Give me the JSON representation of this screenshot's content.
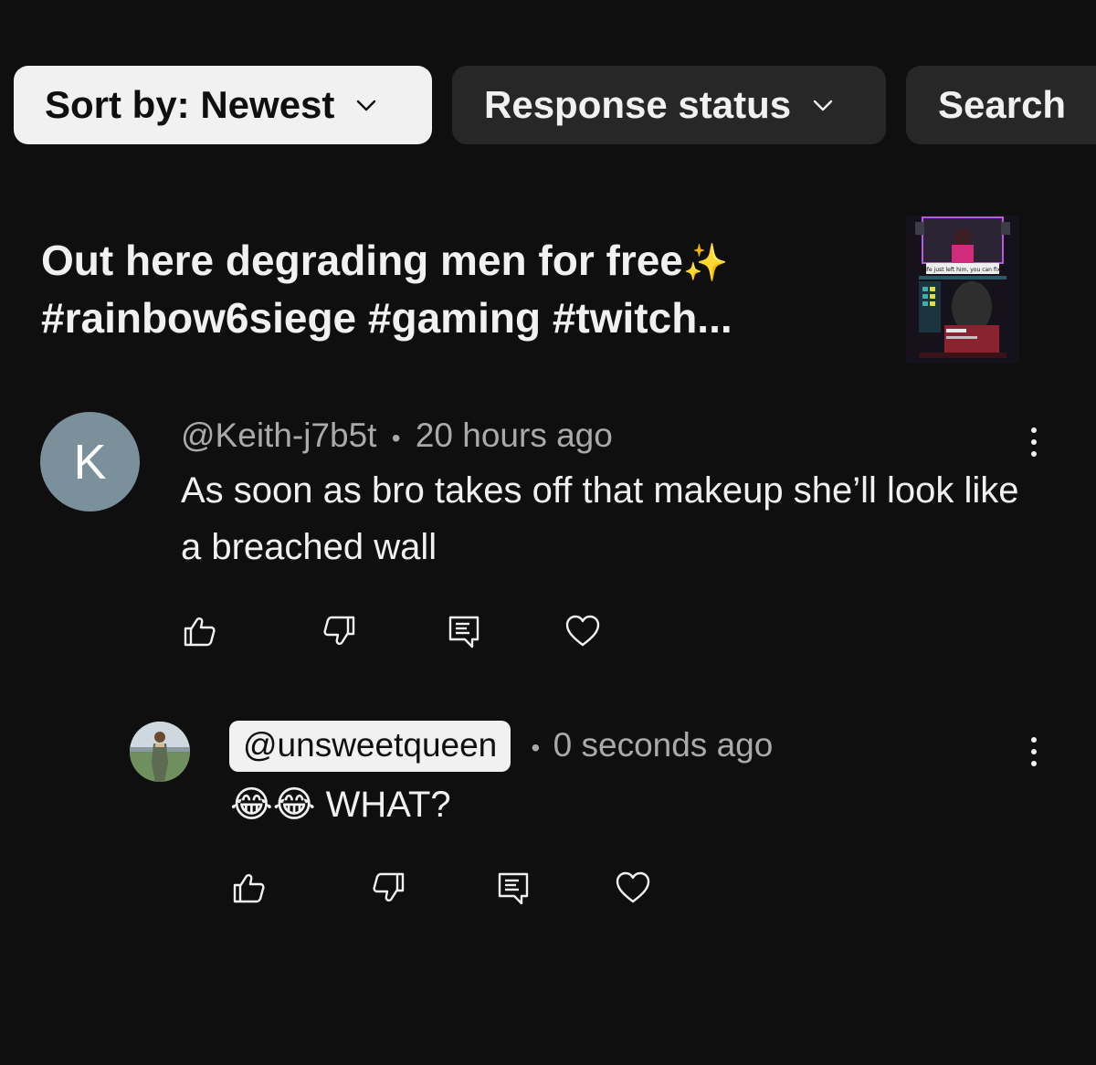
{
  "filters": {
    "sort_label": "Sort by: Newest",
    "status_label": "Response status",
    "search_label": "Search"
  },
  "video": {
    "title_line1": "Out here degrading men for free",
    "title_emoji": "✨",
    "title_line2": "#rainbow6siege #gaming #twitch...",
    "thumbnail_caption": "\"His wife just left him, you can fix him!\""
  },
  "comment": {
    "avatar_letter": "K",
    "author": "@Keith-j7b5t",
    "separator": "•",
    "time": "20 hours ago",
    "text": "As soon as bro takes off that makeup she’ll look like a breached wall"
  },
  "reply": {
    "author": "@unsweetqueen",
    "separator": "•",
    "time": "0 seconds ago",
    "text": "😂😂 WHAT?"
  },
  "icons": {
    "like": "thumbs-up-icon",
    "dislike": "thumbs-down-icon",
    "reply": "comment-icon",
    "heart": "heart-icon",
    "more": "more-vertical-icon"
  }
}
